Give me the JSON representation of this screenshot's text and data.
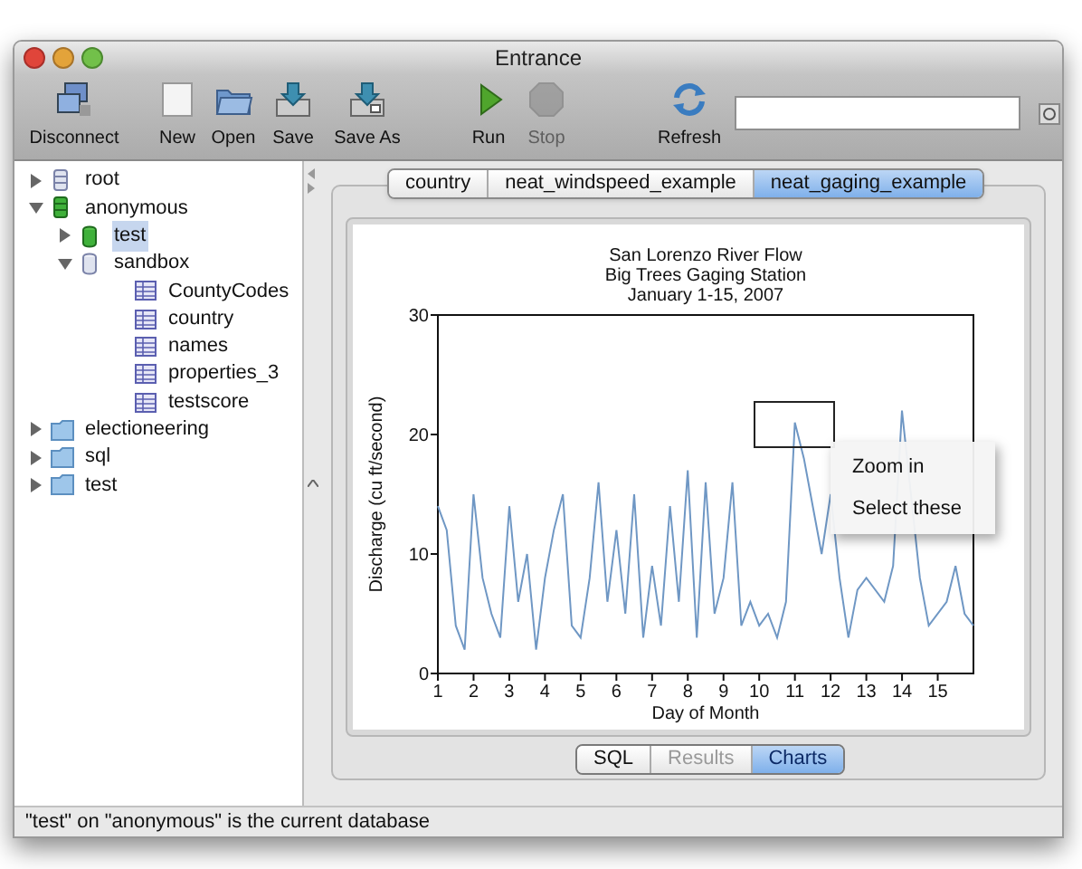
{
  "window": {
    "title": "Entrance"
  },
  "toolbar": [
    {
      "label": "Disconnect",
      "kind": "disconnect",
      "disabled": false
    },
    {
      "label": "New",
      "kind": "new",
      "disabled": false
    },
    {
      "label": "Open",
      "kind": "open",
      "disabled": false
    },
    {
      "label": "Save",
      "kind": "save",
      "disabled": false
    },
    {
      "label": "Save As",
      "kind": "saveas",
      "disabled": false
    },
    {
      "label": "Run",
      "kind": "run",
      "disabled": false
    },
    {
      "label": "Stop",
      "kind": "stop",
      "disabled": true
    },
    {
      "label": "Refresh",
      "kind": "refresh",
      "disabled": false
    }
  ],
  "sidebar": {
    "items": [
      {
        "label": "root",
        "kind": "server",
        "expanded": false,
        "selected": false
      },
      {
        "label": "anonymous",
        "kind": "server-active",
        "expanded": true,
        "selected": false,
        "children": [
          {
            "label": "test",
            "kind": "database-active",
            "expanded": false,
            "selected": true
          },
          {
            "label": "sandbox",
            "kind": "database",
            "expanded": true,
            "selected": false,
            "children": [
              {
                "label": "CountyCodes",
                "kind": "table",
                "selected": false
              },
              {
                "label": "country",
                "kind": "table",
                "selected": false
              },
              {
                "label": "names",
                "kind": "table",
                "selected": false
              },
              {
                "label": "properties_3",
                "kind": "table",
                "selected": false
              },
              {
                "label": "testscore",
                "kind": "table",
                "selected": false
              }
            ]
          }
        ]
      },
      {
        "label": "electioneering",
        "kind": "folder",
        "expanded": false,
        "selected": false
      },
      {
        "label": "sql",
        "kind": "folder",
        "expanded": false,
        "selected": false
      },
      {
        "label": "test",
        "kind": "folder",
        "expanded": false,
        "selected": false
      }
    ]
  },
  "tabs": [
    {
      "label": "country",
      "selected": false
    },
    {
      "label": "neat_windspeed_example",
      "selected": false
    },
    {
      "label": "neat_gaging_example",
      "selected": true
    }
  ],
  "chart": {
    "chart_data": {
      "type": "line",
      "title": "San Lorenzo River Flow\nBig Trees Gaging Station\nJanuary 1-15, 2007",
      "xlabel": "Day of Month",
      "ylabel": "Discharge (cu ft/second)",
      "xlim": [
        1,
        16
      ],
      "ylim": [
        0,
        30
      ],
      "xticks": [
        1,
        2,
        3,
        4,
        5,
        6,
        7,
        8,
        9,
        10,
        11,
        12,
        13,
        14,
        15
      ],
      "yticks": [
        0,
        10,
        20,
        30
      ],
      "x": [
        1,
        1.25,
        1.5,
        1.75,
        2,
        2.25,
        2.5,
        2.75,
        3,
        3.25,
        3.5,
        3.75,
        4,
        4.25,
        4.5,
        4.75,
        5,
        5.25,
        5.5,
        5.75,
        6,
        6.25,
        6.5,
        6.75,
        7,
        7.25,
        7.5,
        7.75,
        8,
        8.25,
        8.5,
        8.75,
        9,
        9.25,
        9.5,
        9.75,
        10,
        10.25,
        10.5,
        10.75,
        11,
        11.25,
        11.5,
        11.75,
        12,
        12.25,
        12.5,
        12.75,
        13,
        13.5,
        13.75,
        14,
        14.5,
        14.75,
        15.25,
        15.5,
        15.75,
        16
      ],
      "series": [
        {
          "color": "#6f97c4",
          "values": [
            14,
            12,
            4,
            2,
            15,
            8,
            5,
            3,
            14,
            6,
            10,
            2,
            8,
            12,
            15,
            4,
            3,
            8,
            16,
            6,
            12,
            5,
            15,
            3,
            9,
            4,
            14,
            6,
            17,
            3,
            16,
            5,
            8,
            16,
            4,
            6,
            4,
            5,
            3,
            6,
            21,
            18,
            14,
            10,
            15,
            8,
            3,
            7,
            8,
            6,
            9,
            22,
            8,
            4,
            6,
            9,
            5,
            4
          ]
        }
      ]
    }
  },
  "context_menu": [
    "Zoom in",
    "Select these"
  ],
  "view_switch": [
    {
      "label": "SQL",
      "selected": false,
      "disabled": false
    },
    {
      "label": "Results",
      "selected": false,
      "disabled": true
    },
    {
      "label": "Charts",
      "selected": true,
      "disabled": false
    }
  ],
  "status_bar": "\"test\" on \"anonymous\" is the current database"
}
